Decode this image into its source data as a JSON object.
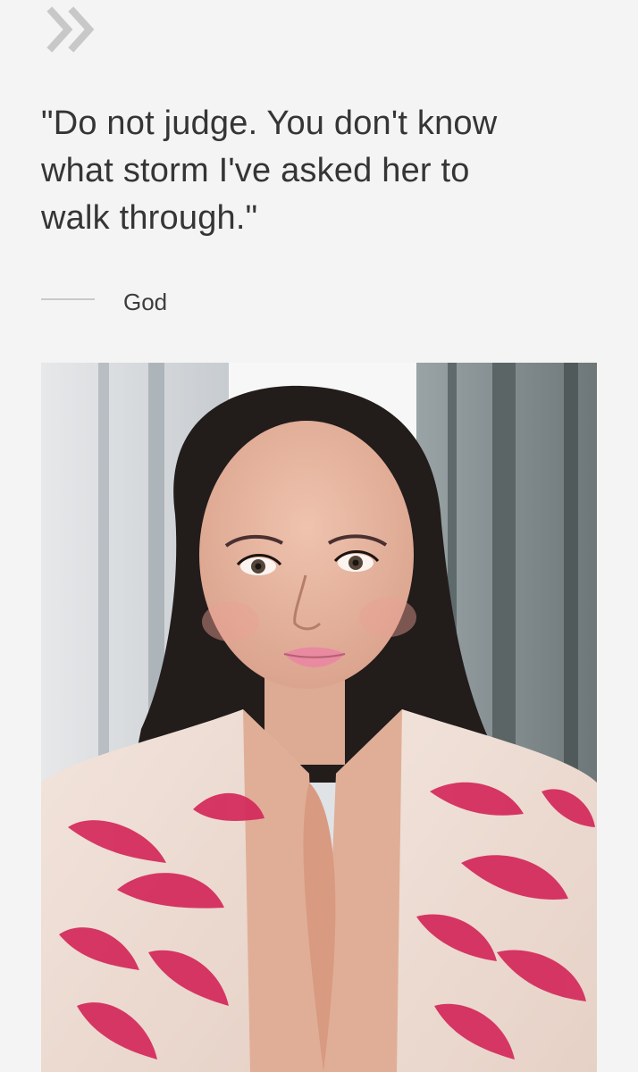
{
  "header": {
    "nav_icon": "double-chevron-right-icon"
  },
  "quote": {
    "text": "\"Do not judge. You don't know\nwhat storm I've asked her to\nwalk through.\"",
    "attribution": "God"
  },
  "image": {
    "subject": "portrait-photo"
  },
  "colors": {
    "background": "#f4f4f4",
    "text": "#353535",
    "icon": "#c8c8c8",
    "divider": "#c9c9c9",
    "accent_pattern": "#d4285a"
  }
}
